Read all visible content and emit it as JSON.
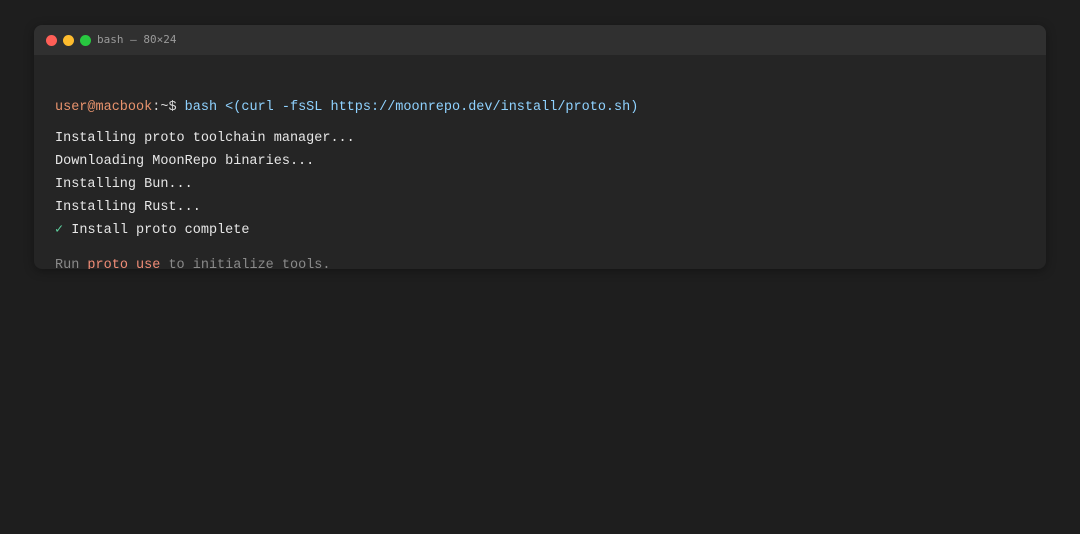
{
  "window": {
    "title": "bash — 80×24"
  },
  "terminal": {
    "prompt": {
      "user_host": "user@macbook",
      "separator": ":",
      "path": "~",
      "symbol": "$",
      "command": "bash <(curl -fsSL https://moonrepo.dev/install/proto.sh)"
    },
    "output": [
      "Installing proto toolchain manager...",
      "Downloading MoonRepo binaries...",
      "Installing Bun...",
      "Installing Rust..."
    ],
    "success": {
      "mark": "✓",
      "text": "Install proto complete"
    },
    "hint": {
      "prefix": "Run",
      "highlight": "proto use",
      "suffix": "to initialize tools."
    }
  },
  "colors": {
    "background": "#1e1e1e",
    "window": "#252525",
    "titlebar": "#303030",
    "close": "#ff5f57",
    "minimize": "#febc2e",
    "maximize": "#28c840",
    "prompt_user": "#e8936d",
    "command": "#8fd2ff",
    "check": "#5fd2a0",
    "hint_highlight": "#f08c76"
  }
}
